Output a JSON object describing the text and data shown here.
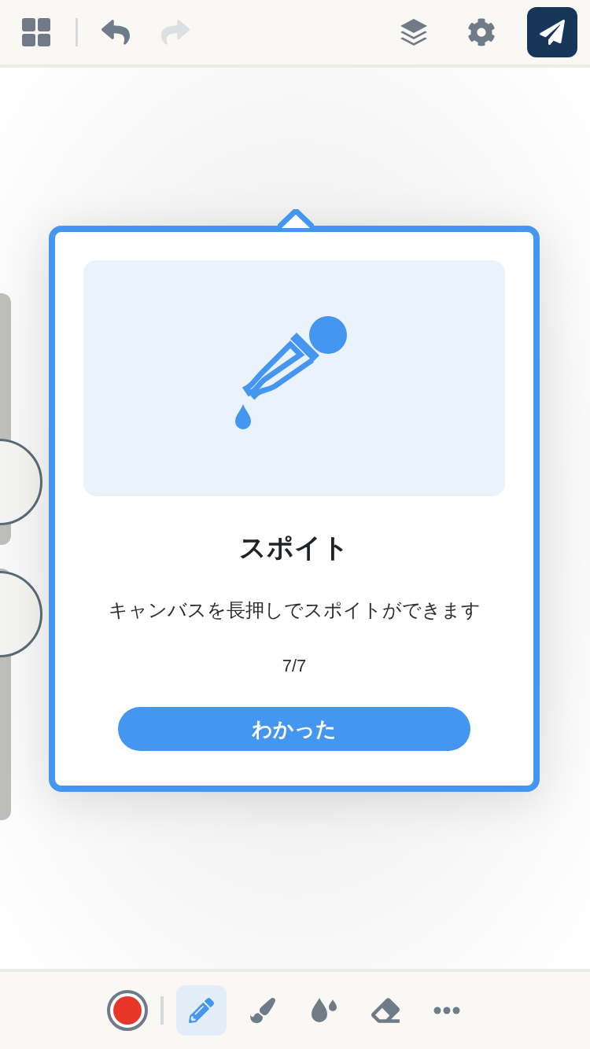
{
  "top_bar": {
    "undo": {
      "disabled": false
    },
    "redo": {
      "disabled": true
    }
  },
  "sliders": [
    {
      "level": 0.25
    },
    {
      "level": 0.82
    }
  ],
  "popup": {
    "title": "スポイト",
    "description": "キャンバスを長押しでスポイトができます",
    "page": "7/7",
    "button": "わかった"
  },
  "toolbar": {
    "color": "#e8372a",
    "tools": [
      {
        "kind": "pencil",
        "selected": true
      },
      {
        "kind": "brush",
        "selected": false
      },
      {
        "kind": "drops",
        "selected": false
      },
      {
        "kind": "eraser",
        "selected": false
      },
      {
        "kind": "more",
        "selected": false
      }
    ]
  }
}
